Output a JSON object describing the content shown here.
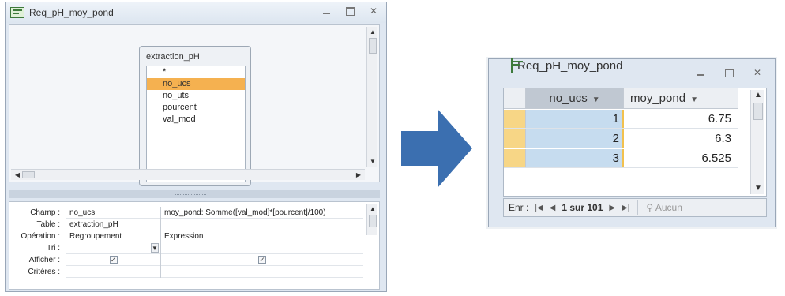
{
  "design_window": {
    "title": "Req_pH_moy_pond",
    "table_box": {
      "title": "extraction_pH",
      "fields": [
        "*",
        "no_ucs",
        "no_uts",
        "pourcent",
        "val_mod"
      ],
      "selected_field": "no_ucs"
    },
    "grid": {
      "row_labels": [
        "Champ :",
        "Table :",
        "Opération :",
        "Tri :",
        "Afficher :",
        "Critères :"
      ],
      "columns": [
        {
          "champ": "no_ucs",
          "table": "extraction_pH",
          "operation": "Regroupement",
          "tri": "",
          "afficher": true
        },
        {
          "champ": "moy_pond: Somme([val_mod]*[pourcent]/100)",
          "table": "",
          "operation": "Expression",
          "tri": "",
          "afficher": true
        }
      ]
    }
  },
  "datasheet_window": {
    "title": "Req_pH_moy_pond",
    "columns": [
      "no_ucs",
      "moy_pond"
    ],
    "rows": [
      {
        "no_ucs": "1",
        "moy_pond": "6.75"
      },
      {
        "no_ucs": "2",
        "moy_pond": "6.3"
      },
      {
        "no_ucs": "3",
        "moy_pond": "6.525"
      }
    ],
    "nav": {
      "label": "Enr :",
      "record": "1 sur 101",
      "filter": "Aucun"
    }
  },
  "icons": {
    "sort": "dropdown-arrow",
    "close": "✕",
    "arrow_color": "#3b6fb0"
  }
}
